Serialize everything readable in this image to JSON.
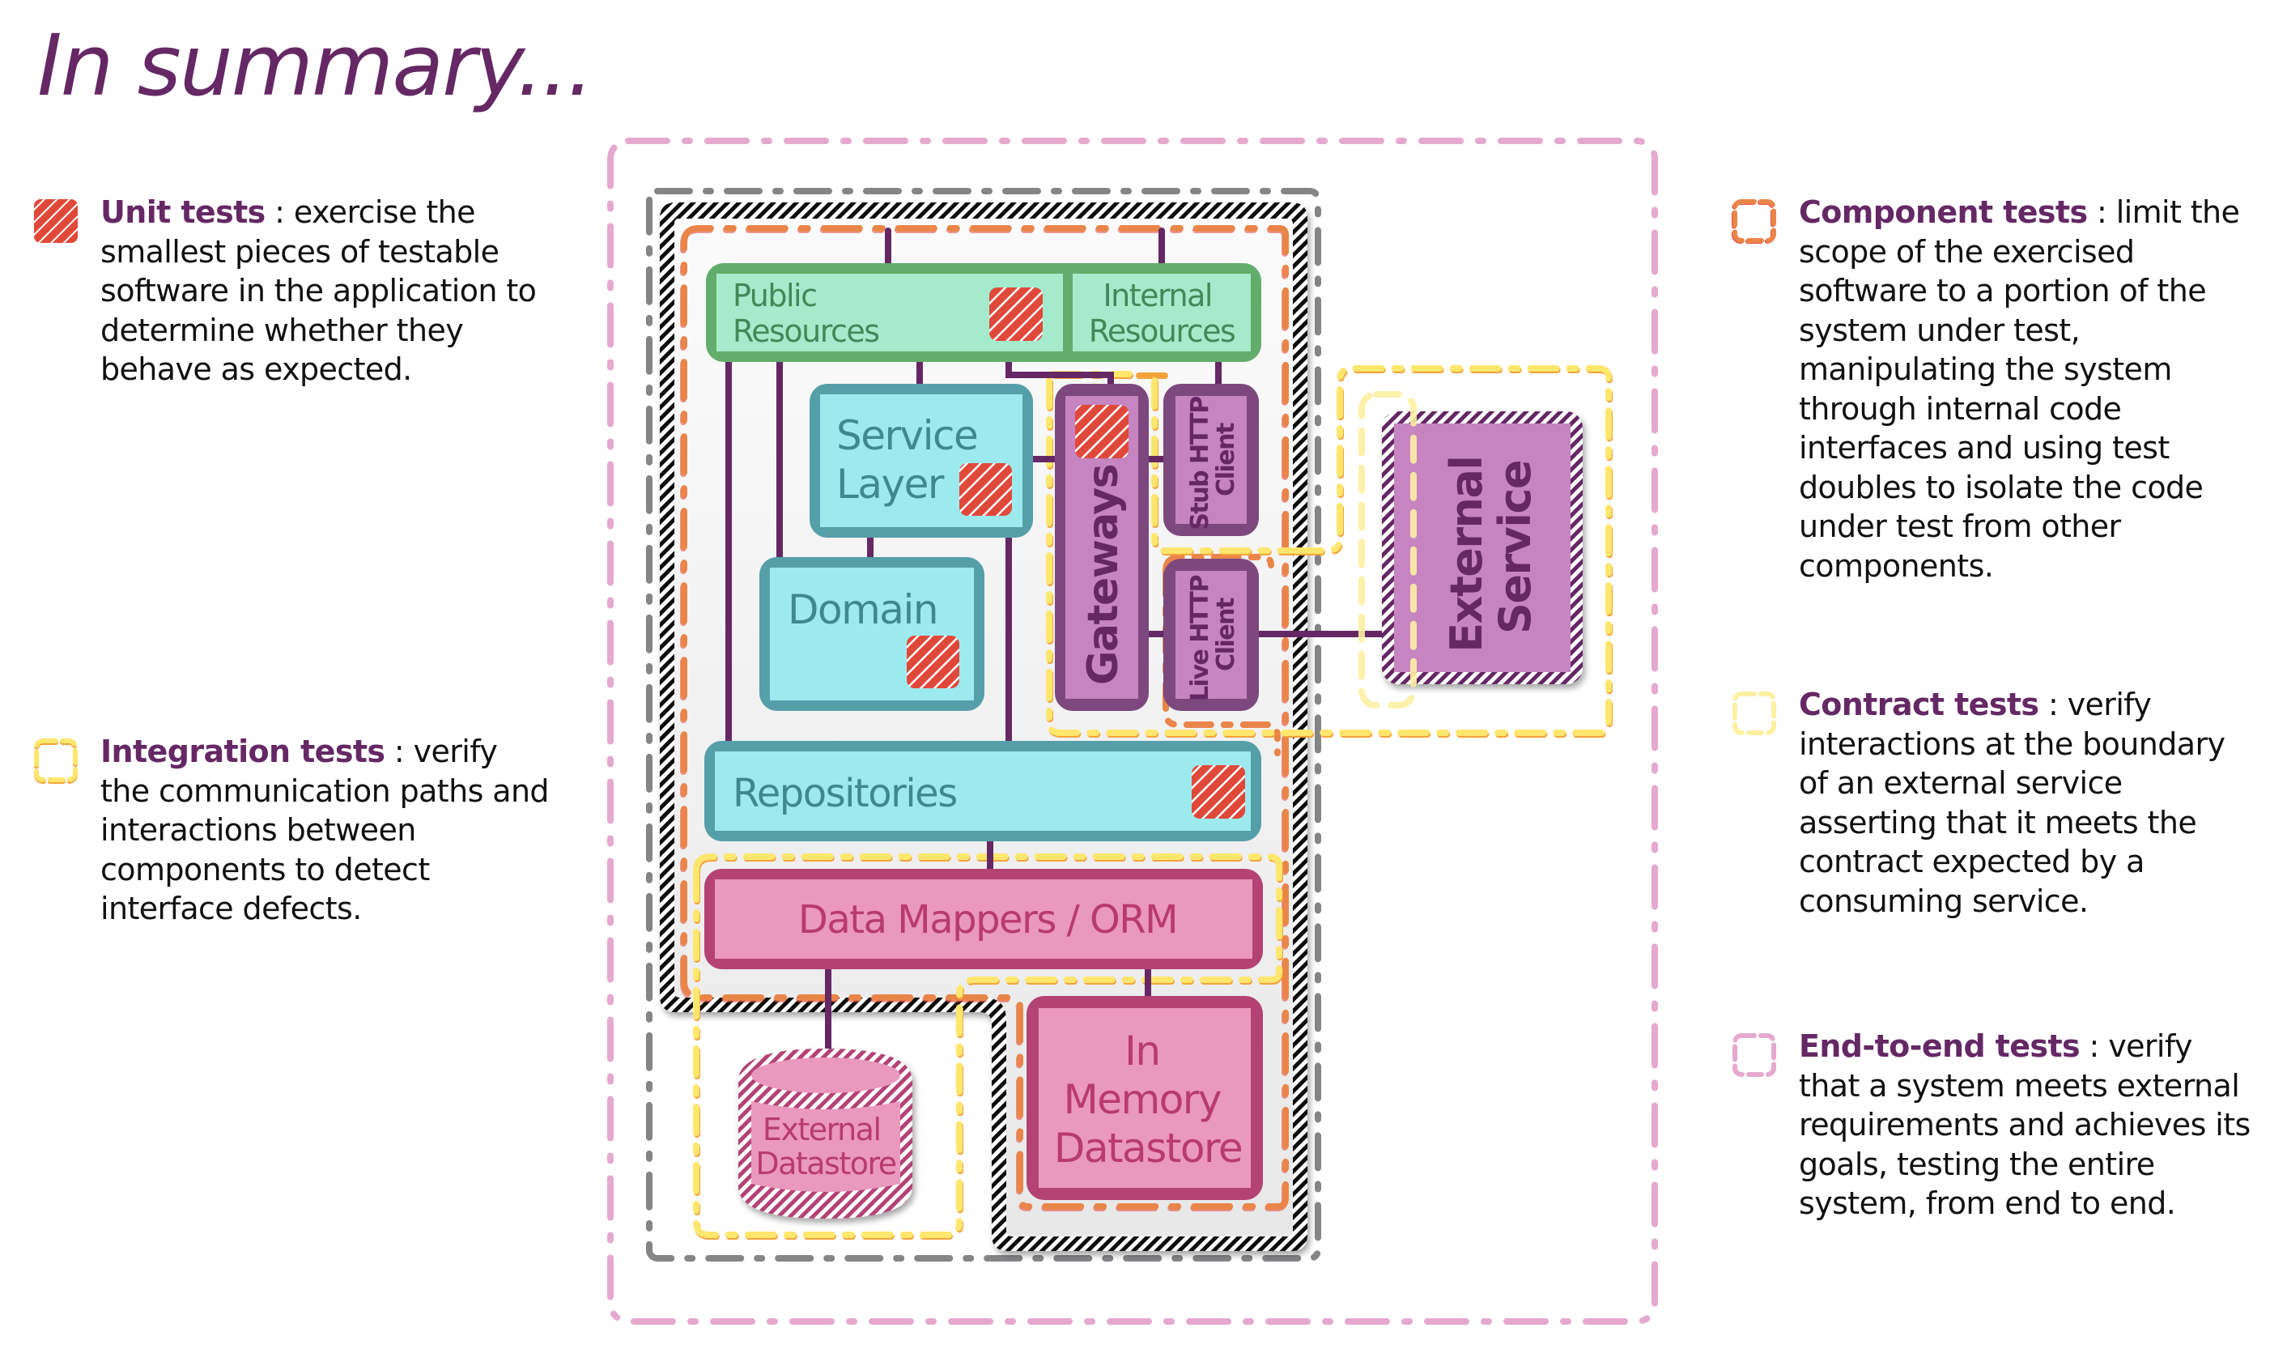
{
  "title": "In summary...",
  "legend": {
    "unit": {
      "name": "Unit tests",
      "sep": " : ",
      "text": "exercise the smallest pieces of testable software in the application to determine whether they behave as expected.",
      "icon": "hatched-red-square-icon",
      "color": "#e0493a"
    },
    "integration": {
      "name": "Integration tests",
      "sep": " : ",
      "text": "verify the communication paths and interactions between components to detect interface defects.",
      "icon": "yellow-dashed-box-icon",
      "color": "#ffe66d"
    },
    "component": {
      "name": "Component tests",
      "sep": " : ",
      "text": "limit the scope of the exercised software to a portion of the system under test, manipulating the system through internal code interfaces and using test doubles to isolate the code under test from other components.",
      "icon": "orange-dashed-box-icon",
      "color": "#ea8549"
    },
    "contract": {
      "name": "Contract tests",
      "sep": " : ",
      "text": "verify interactions at the boundary of an external service asserting that it meets the contract expected by a consuming service.",
      "icon": "pale-yellow-dashed-box-icon",
      "color": "#fdf0a2"
    },
    "e2e": {
      "name": "End-to-end tests",
      "sep": " : ",
      "text": "verify that a system meets external requirements and achieves its goals, testing the entire system, from end to end.",
      "icon": "pink-dashed-box-icon",
      "color": "#e5a9cf"
    }
  },
  "diagram": {
    "public_resources": [
      "Public",
      "Resources"
    ],
    "internal_resources": [
      "Internal",
      "Resources"
    ],
    "service_layer": [
      "Service",
      "Layer"
    ],
    "domain": "Domain",
    "gateways": "Gateways",
    "stub_http_client": [
      "Stub HTTP",
      "Client"
    ],
    "live_http_client": [
      "Live HTTP",
      "Client"
    ],
    "repositories": "Repositories",
    "data_mappers": "Data Mappers / ORM",
    "in_memory_datastore": [
      "In",
      "Memory",
      "Datastore"
    ],
    "external_datastore": [
      "External",
      "Datastore"
    ],
    "external_service": [
      "External",
      "Service"
    ]
  },
  "colors": {
    "title": "#652865",
    "green_border": "#62ad6b",
    "green_fill": "#a4ebcb",
    "green_text": "#3f8a57",
    "teal_border": "#559fa9",
    "teal_fill": "#9deaee",
    "teal_text": "#3f8890",
    "purple_border": "#7d487d",
    "purple_fill": "#c684c1",
    "purple_text": "#652865",
    "pink_border": "#b44374",
    "pink_fill": "#ea98bd",
    "pink_text": "#b83a70",
    "connector": "#652865",
    "gray_dash": "#858588"
  }
}
